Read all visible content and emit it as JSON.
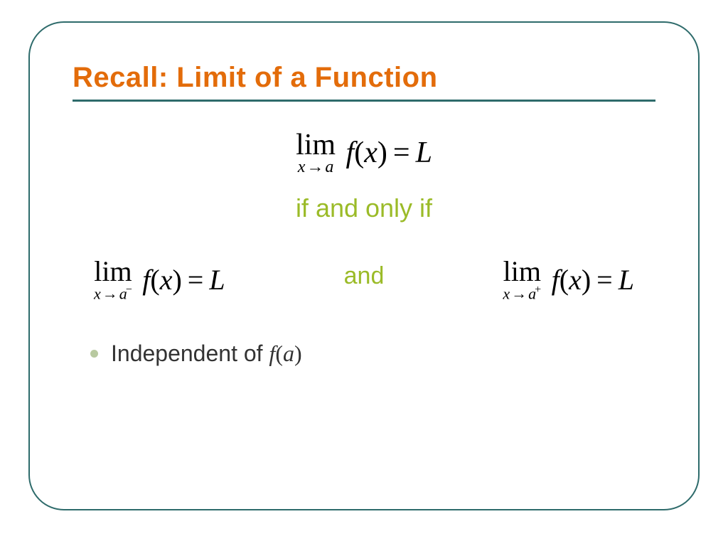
{
  "title": "Recall: Limit of a Function",
  "equations": {
    "main": {
      "lim": "lim",
      "sub_x": "x",
      "sub_arrow": "→",
      "sub_a": "a",
      "f": "f",
      "x": "x",
      "L": "L"
    },
    "left": {
      "lim": "lim",
      "sub_x": "x",
      "sub_arrow": "→",
      "sub_a": "a",
      "sup": "−",
      "f": "f",
      "x": "x",
      "L": "L"
    },
    "right": {
      "lim": "lim",
      "sub_x": "x",
      "sub_arrow": "→",
      "sub_a": "a",
      "sup": "+",
      "f": "f",
      "x": "x",
      "L": "L"
    }
  },
  "connectors": {
    "iff": "if and only if",
    "and": "and"
  },
  "bullet": {
    "text": "Independent of ",
    "f": "f",
    "a": "a"
  },
  "colors": {
    "title": "#e36c0a",
    "frame": "#2e6b6b",
    "accent": "#9bbb28"
  }
}
